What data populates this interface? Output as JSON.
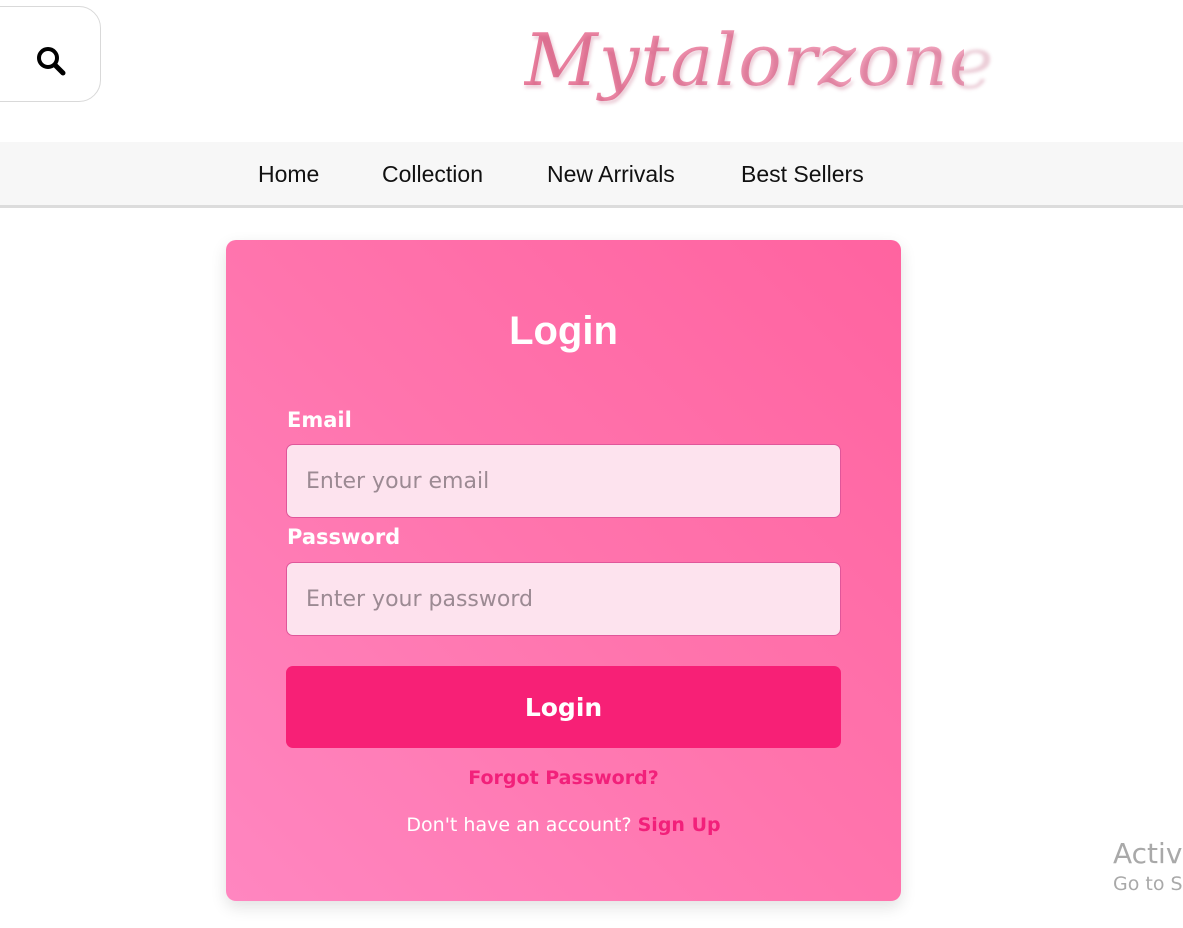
{
  "search": {
    "icon": "search-icon"
  },
  "brand": {
    "logo_text": "Mytalorzone"
  },
  "nav": {
    "items": [
      {
        "label": "Home"
      },
      {
        "label": "Collection"
      },
      {
        "label": "New Arrivals"
      },
      {
        "label": "Best Sellers"
      }
    ]
  },
  "login": {
    "title": "Login",
    "email_label": "Email",
    "email_placeholder": "Enter your email",
    "email_value": "",
    "password_label": "Password",
    "password_placeholder": "Enter your password",
    "password_value": "",
    "submit_label": "Login",
    "forgot_label": "Forgot Password?",
    "signup_prompt": "Don't have an account?",
    "signup_label": "Sign Up"
  },
  "watermark": {
    "title": "Activa",
    "subtitle": "Go to S"
  },
  "colors": {
    "accent": "#f72076",
    "card": "#ff74ad",
    "input_bg": "#fde3ee",
    "link": "#f2207a",
    "logo": "#ec8fa8"
  }
}
